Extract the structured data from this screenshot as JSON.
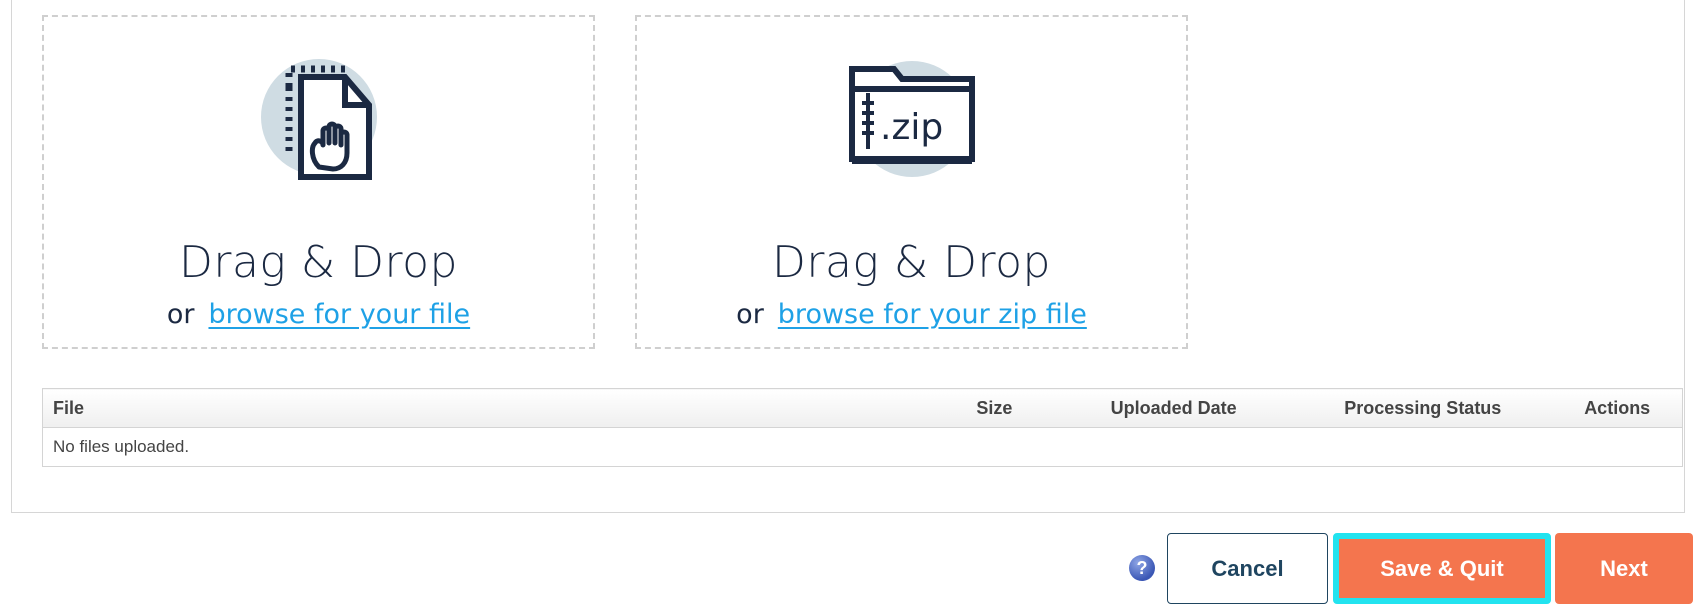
{
  "uploads": {
    "file_zone": {
      "title": "Drag & Drop",
      "or_text": "or",
      "browse_link": "browse for your file",
      "icon": "drag-file-icon"
    },
    "zip_zone": {
      "title": "Drag & Drop",
      "or_text": "or",
      "browse_link": "browse for your zip file",
      "icon": "zip-folder-icon",
      "icon_text": ".zip"
    }
  },
  "files_table": {
    "columns": {
      "file": "File",
      "size": "Size",
      "uploaded_date": "Uploaded Date",
      "processing_status": "Processing Status",
      "actions": "Actions"
    },
    "empty_message": "No files uploaded."
  },
  "footer": {
    "help_icon_glyph": "?",
    "cancel_label": "Cancel",
    "save_quit_label": "Save & Quit",
    "next_label": "Next"
  },
  "colors": {
    "navy": "#1b2942",
    "link": "#1ea1e6",
    "accent_orange": "#f4754e",
    "focus_cyan": "#22e3ef",
    "icon_circle": "#cfdce3"
  }
}
